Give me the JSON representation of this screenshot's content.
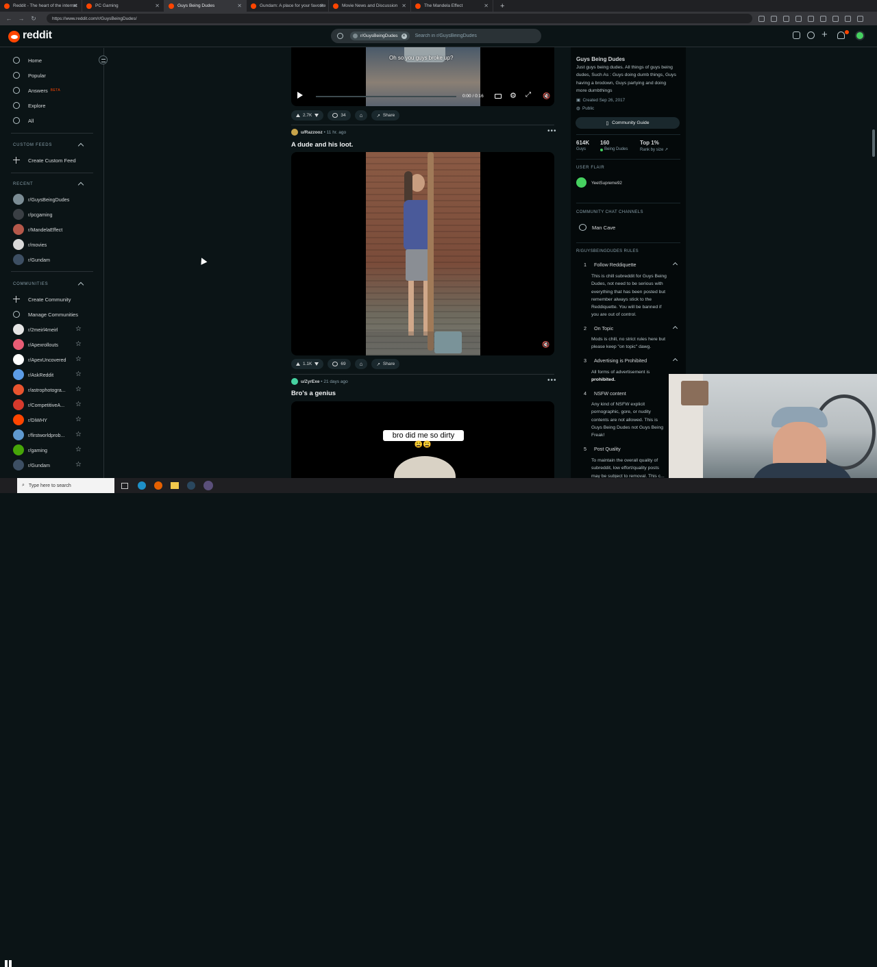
{
  "browser": {
    "tabs": [
      {
        "title": "Reddit - The heart of the internet",
        "active": false
      },
      {
        "title": "PC Gaming",
        "active": false
      },
      {
        "title": "Guys Being Dudes",
        "active": true
      },
      {
        "title": "Gundam: A place for your favorite",
        "active": false
      },
      {
        "title": "Movie News and Discussion",
        "active": false
      },
      {
        "title": "The Mandela Effect",
        "active": false
      }
    ],
    "new_tab": "+",
    "url": "https://www.reddit.com/r/GuysBeingDudes/"
  },
  "header": {
    "logo_text": "reddit",
    "search_chip": "r/GuysBeingDudes",
    "search_placeholder": "Search in r/GuysBeingDudes",
    "brand_color": "#ff4500"
  },
  "leftnav": {
    "main": [
      {
        "label": "Home",
        "icon": "home-icon"
      },
      {
        "label": "Popular",
        "icon": "popular-icon"
      },
      {
        "label": "Answers",
        "icon": "answers-icon",
        "badge": "BETA"
      },
      {
        "label": "Explore",
        "icon": "explore-icon"
      },
      {
        "label": "All",
        "icon": "all-icon"
      }
    ],
    "custom_feeds_head": "CUSTOM FEEDS",
    "create_custom_feed": "Create Custom Feed",
    "recent_head": "RECENT",
    "recent": [
      {
        "name": "r/GuysBeingDudes",
        "color": "#7b8c94"
      },
      {
        "name": "r/pcgaming",
        "color": "#3a3f44"
      },
      {
        "name": "r/MandelaEffect",
        "color": "#b4584a"
      },
      {
        "name": "r/movies",
        "color": "#d8d8d8"
      },
      {
        "name": "r/Gundam",
        "color": "#3d4f63"
      }
    ],
    "communities_head": "COMMUNITIES",
    "create_community": "Create Community",
    "manage_communities": "Manage Communities",
    "communities": [
      {
        "name": "r/2meirl4meirl",
        "color": "#e5e5e5"
      },
      {
        "name": "r/Apexrollouts",
        "color": "#e85d75"
      },
      {
        "name": "r/ApexUncovered",
        "color": "#ffffff"
      },
      {
        "name": "r/AskReddit",
        "color": "#5c9ce6"
      },
      {
        "name": "r/astrophotogra...",
        "color": "#e8542f"
      },
      {
        "name": "r/CompetitiveA...",
        "color": "#d63a2c"
      },
      {
        "name": "r/DiWHY",
        "color": "#ff4500"
      },
      {
        "name": "r/firstworldprob...",
        "color": "#5f99cf"
      },
      {
        "name": "r/gaming",
        "color": "#46a508"
      },
      {
        "name": "r/Gundam",
        "color": "#3d4f63"
      }
    ]
  },
  "feed": {
    "post0": {
      "caption": "Oh so you guys broke up?",
      "time": "0:00 / 0:16",
      "progress": 0.0,
      "votes": "2.7K",
      "comments": "34",
      "share": "Share"
    },
    "post1": {
      "user": "u/Razzooz",
      "age": "11 hr. ago",
      "title": "A dude and his loot.",
      "votes": "1.1K",
      "comments": "69",
      "share": "Share"
    },
    "post2": {
      "user": "u/ZyrExe",
      "age": "21 days ago",
      "title": "Bro's a genius",
      "caption": "bro did me so dirty",
      "emoji": "😩😩"
    }
  },
  "sidebar": {
    "title": "Guys Being Dudes",
    "description": "Just guys being dudes. All things of guys being dudes, Such As : Guys doing dumb things, Guys having a brodown, Guys partying and doing more dumbthings",
    "created": "Created Sep 26, 2017",
    "visibility": "Public",
    "community_guide": "Community Guide",
    "stats": [
      {
        "value": "614K",
        "label": "Guys"
      },
      {
        "value": "160",
        "label": "Being Dudes",
        "online": true
      },
      {
        "value": "Top 1%",
        "label": "Rank by size"
      }
    ],
    "user_flair_head": "USER FLAIR",
    "flair_user": "YeetSupreme92",
    "chat_head": "COMMUNITY CHAT CHANNELS",
    "chat_channel": "Man Cave",
    "rules_head": "R/GUYSBEINGDUDES RULES",
    "rules": [
      {
        "n": "1",
        "title": "Follow Reddiquette",
        "body": [
          "This is chill subreddit for Guys Being",
          "Dudes, not need to be serious with",
          "everything that has been posted but",
          "remember always stick to the",
          "Reddiquette. You will be banned if",
          "you are out of control."
        ]
      },
      {
        "n": "2",
        "title": "On Topic",
        "body": [
          "Mods is chill, no strict rules here but",
          "please keep \"on topic\" dawg."
        ]
      },
      {
        "n": "3",
        "title": "Advertising is Prohibited",
        "body": [
          "All forms of advertisement is",
          "prohibited."
        ]
      },
      {
        "n": "4",
        "title": "NSFW content",
        "body": [
          "Any kind of NSFW explicit",
          "pornographic, gore, or nudity",
          "contents are not allowed. This is",
          "Guys Being Dudes not Guys Being",
          "Freak!"
        ]
      },
      {
        "n": "5",
        "title": "Post Quality",
        "body": [
          "To maintain the overall quality of",
          "subreddit, low effort/quality posts",
          "may be subject to removal. This c..."
        ]
      }
    ]
  },
  "taskbar": {
    "search_placeholder": "Type here to search"
  }
}
